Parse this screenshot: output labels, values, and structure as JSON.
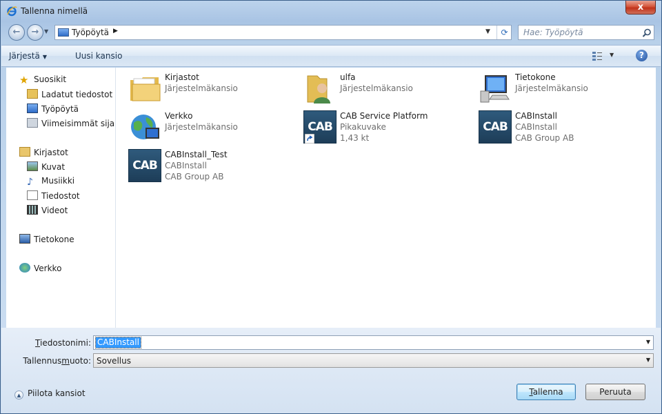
{
  "window": {
    "title": "Tallenna nimellä",
    "close_label": "x"
  },
  "navigation": {
    "back_label": "←",
    "forward_label": "→",
    "address": "Työpöytä",
    "search_placeholder": "Hae: Työpöytä"
  },
  "toolbar": {
    "organize_label": "Järjestä",
    "new_folder_label": "Uusi kansio",
    "help_label": "?"
  },
  "sidebar": {
    "favorites": {
      "label": "Suosikit",
      "items": [
        "Ladatut tiedostot",
        "Työpöytä",
        "Viimeisimmät sijainnit"
      ]
    },
    "libraries": {
      "label": "Kirjastot",
      "items": [
        "Kuvat",
        "Musiikki",
        "Tiedostot",
        "Videot"
      ]
    },
    "computer_label": "Tietokone",
    "network_label": "Verkko"
  },
  "files": [
    {
      "name": "Kirjastot",
      "line1": "Järjestelmäkansio",
      "line2": "",
      "icon": "libraries-folder-icon"
    },
    {
      "name": "ulfa",
      "line1": "Järjestelmäkansio",
      "line2": "",
      "icon": "user-folder-icon"
    },
    {
      "name": "Tietokone",
      "line1": "Järjestelmäkansio",
      "line2": "",
      "icon": "computer-icon"
    },
    {
      "name": "Verkko",
      "line1": "Järjestelmäkansio",
      "line2": "",
      "icon": "network-icon"
    },
    {
      "name": "CAB Service Platform",
      "line1": "Pikakuvake",
      "line2": "1,43 kt",
      "icon": "cab-shortcut-icon"
    },
    {
      "name": "CABInstall",
      "line1": "CABInstall",
      "line2": "CAB Group AB",
      "icon": "cab-app-icon"
    },
    {
      "name": "CABInstall_Test",
      "line1": "CABInstall",
      "line2": "CAB Group AB",
      "icon": "cab-app-icon"
    }
  ],
  "cab_logo_text": "CAB",
  "form": {
    "filename_label_pre": "",
    "filename_label_u": "T",
    "filename_label_post": "iedostonimi:",
    "filename_value": "CABInstall",
    "filetype_label_pre": "Tallennus",
    "filetype_label_u": "m",
    "filetype_label_post": "uoto:",
    "filetype_value": "Sovellus"
  },
  "footer": {
    "hide_folders_label": "Piilota kansiot",
    "save_pre": "",
    "save_u": "T",
    "save_post": "allenna",
    "cancel_label": "Peruuta"
  }
}
